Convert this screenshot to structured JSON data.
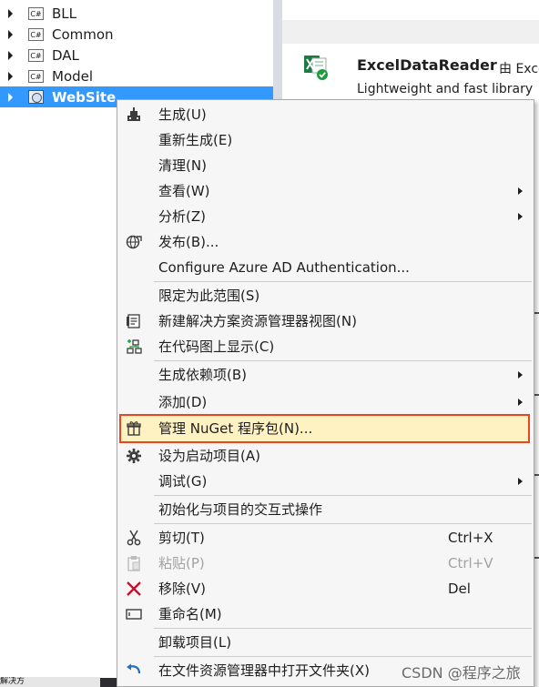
{
  "tree": {
    "items": [
      {
        "label": "BLL",
        "icon": "csharp-project-icon",
        "badge": "C#"
      },
      {
        "label": "Common",
        "icon": "csharp-project-icon",
        "badge": "C#"
      },
      {
        "label": "DAL",
        "icon": "csharp-project-icon",
        "badge": "C#"
      },
      {
        "label": "Model",
        "icon": "csharp-project-icon",
        "badge": "C#"
      },
      {
        "label": "WebSite",
        "icon": "web-project-icon",
        "selected": true
      }
    ]
  },
  "package": {
    "name": "ExcelDataReader",
    "by": "由 Exce",
    "description": "Lightweight and fast library",
    "icon": "excel-package-icon",
    "installed_icon": "check-badge-icon"
  },
  "menu": {
    "items": [
      {
        "label": "生成(U)",
        "icon": "build-icon"
      },
      {
        "label": "重新生成(E)"
      },
      {
        "label": "清理(N)"
      },
      {
        "label": "查看(W)",
        "submenu": true
      },
      {
        "label": "分析(Z)",
        "submenu": true
      },
      {
        "label": "发布(B)...",
        "icon": "publish-globe-icon"
      },
      {
        "label": "Configure Azure AD Authentication..."
      },
      {
        "label": "限定为此范围(S)"
      },
      {
        "label": "新建解决方案资源管理器视图(N)",
        "icon": "new-view-icon"
      },
      {
        "label": "在代码图上显示(C)",
        "icon": "code-map-icon"
      },
      {
        "label": "生成依赖项(B)",
        "submenu": true
      },
      {
        "label": "添加(D)",
        "submenu": true
      },
      {
        "label": "管理 NuGet 程序包(N)...",
        "icon": "nuget-package-icon",
        "highlight": true
      },
      {
        "label": "设为启动项目(A)",
        "icon": "gear-icon"
      },
      {
        "label": "调试(G)",
        "submenu": true
      },
      {
        "label": "初始化与项目的交互式操作"
      },
      {
        "label": "剪切(T)",
        "icon": "scissors-icon",
        "shortcut": "Ctrl+X"
      },
      {
        "label": "粘贴(P)",
        "icon": "paste-icon",
        "shortcut": "Ctrl+V",
        "disabled": true
      },
      {
        "label": "移除(V)",
        "icon": "remove-x-icon",
        "shortcut": "Del"
      },
      {
        "label": "重命名(M)",
        "icon": "rename-icon"
      },
      {
        "label": "卸载项目(L)"
      },
      {
        "label": "在文件资源管理器中打开文件夹(X)",
        "icon": "open-folder-arrow-icon"
      }
    ]
  },
  "watermark": "CSDN @程序之旅",
  "bottom_tab": "解决方",
  "colors": {
    "selection": "#3399ff",
    "highlight_bg": "#fff2c2",
    "highlight_border": "#e8471d",
    "remove_red": "#c8102e",
    "open_folder_blue": "#1e6fc5"
  }
}
